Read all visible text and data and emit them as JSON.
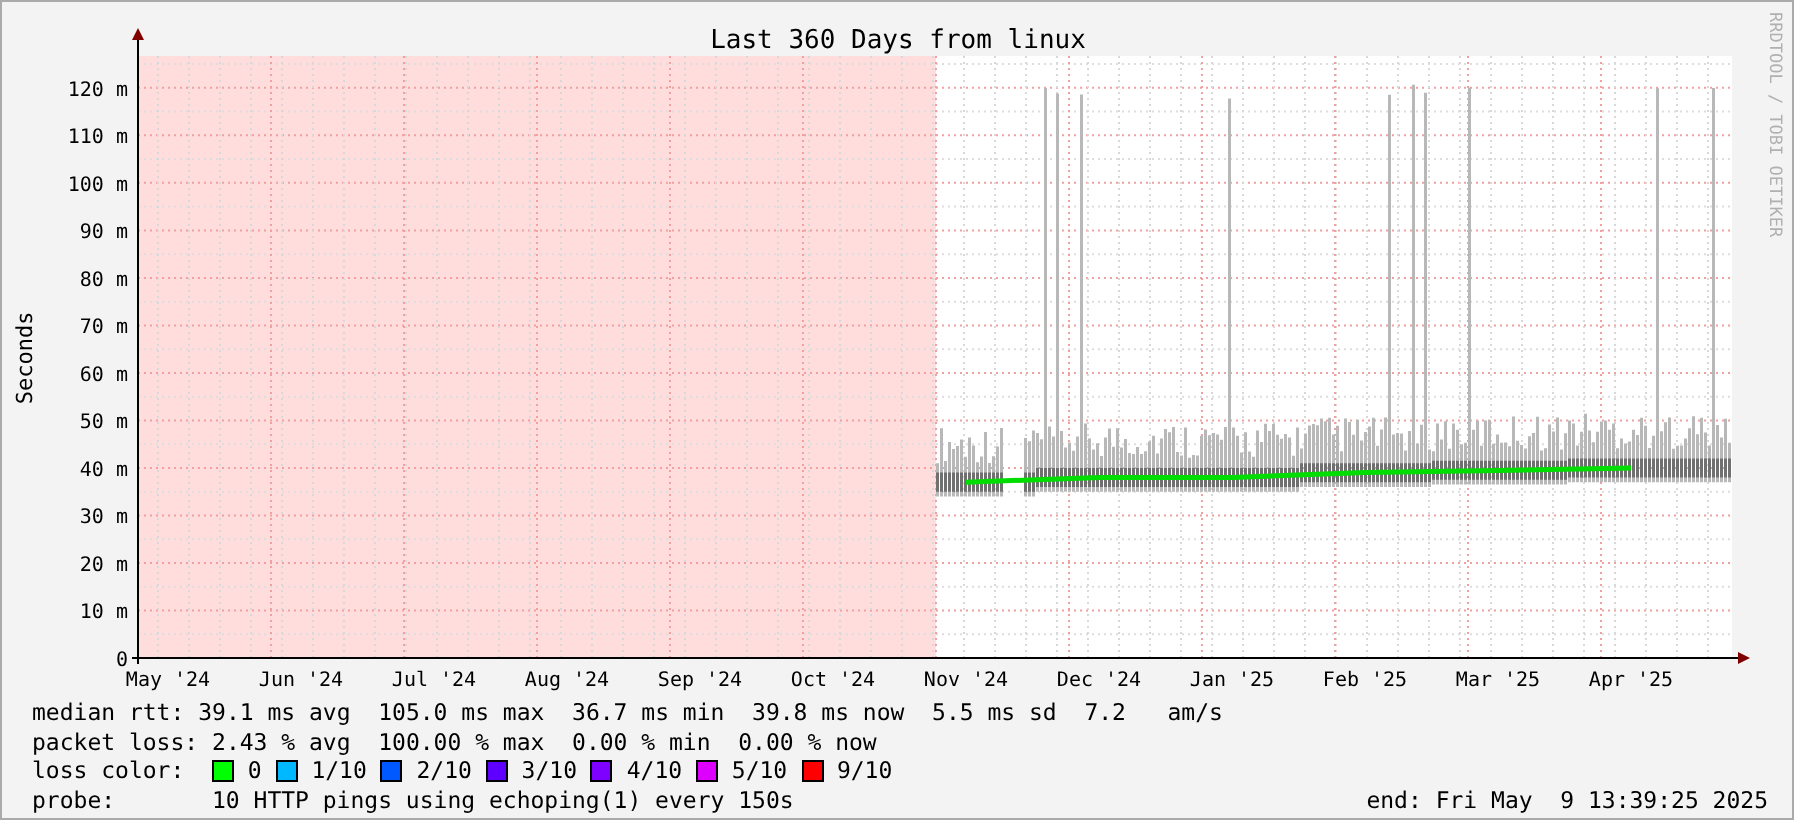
{
  "graph": {
    "side_text": "RRDTOOL / TOBI OETIKER",
    "chart_data": {
      "type": "line",
      "title": "Last 360 Days from linux",
      "ylabel": "Seconds",
      "grid": true,
      "ylim": [
        0,
        126.7
      ],
      "categories": [
        "May '24",
        "Jun '24",
        "Jul '24",
        "Aug '24",
        "Sep '24",
        "Oct '24",
        "Nov '24",
        "Dec '24",
        "Jan '25",
        "Feb '25",
        "Mar '25",
        "Apr '25"
      ],
      "yticks": [
        {
          "value": 0,
          "label": "0"
        },
        {
          "value": 10,
          "label": "10 m"
        },
        {
          "value": 20,
          "label": "20 m"
        },
        {
          "value": 30,
          "label": "30 m"
        },
        {
          "value": 40,
          "label": "40 m"
        },
        {
          "value": 50,
          "label": "50 m"
        },
        {
          "value": 60,
          "label": "60 m"
        },
        {
          "value": 70,
          "label": "70 m"
        },
        {
          "value": 80,
          "label": "80 m"
        },
        {
          "value": 90,
          "label": "90 m"
        },
        {
          "value": 100,
          "label": "100 m"
        },
        {
          "value": 110,
          "label": "110 m"
        },
        {
          "value": 120,
          "label": "120 m"
        }
      ],
      "series": [
        {
          "color": "#00dd00",
          "values": [
            null,
            null,
            null,
            null,
            null,
            null,
            37,
            38,
            38,
            39,
            39.5,
            40
          ]
        }
      ]
    }
  },
  "legend": {
    "rows": [
      {
        "kind": "stats",
        "label": "median rtt:",
        "text": "39.1 ms avg  105.0 ms max  36.7 ms min  39.8 ms now  5.5 ms sd  7.2   am/s"
      },
      {
        "kind": "stats",
        "label": "packet loss:",
        "text": "2.43 % avg  100.00 % max  0.00 % min  0.00 % now"
      },
      {
        "kind": "swatches",
        "label": "loss color:",
        "swatches": [
          {
            "label": "0",
            "color": "#00ff00"
          },
          {
            "label": "1/10",
            "color": "#00b8ff"
          },
          {
            "label": "2/10",
            "color": "#0059ff"
          },
          {
            "label": "3/10",
            "color": "#5e00ff"
          },
          {
            "label": "4/10",
            "color": "#7e00ff"
          },
          {
            "label": "5/10",
            "color": "#dd00ff"
          },
          {
            "label": "9/10",
            "color": "#ff0000"
          }
        ]
      },
      {
        "kind": "probe",
        "label": "probe:",
        "text": "10 HTTP pings using echoping(1) every 150s",
        "end": "end: Fri May  9 13:39:25 2025"
      }
    ]
  }
}
